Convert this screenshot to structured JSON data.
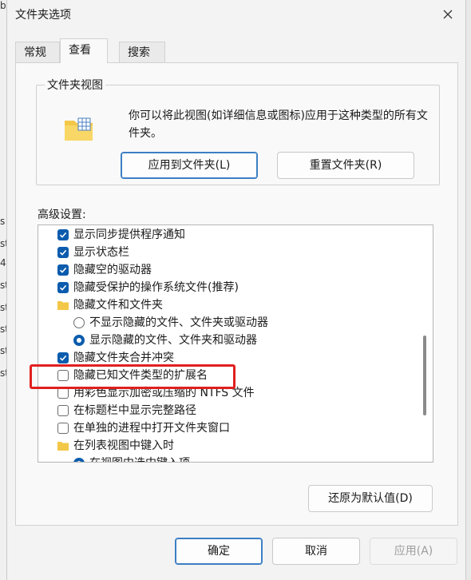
{
  "window": {
    "title": "文件夹选项",
    "close_glyph": "✕"
  },
  "tabs": [
    {
      "label": "常规",
      "active": false
    },
    {
      "label": "查看",
      "active": true
    },
    {
      "label": "搜索",
      "active": false
    }
  ],
  "folder_views": {
    "group_title": "文件夹视图",
    "description": "你可以将此视图(如详细信息或图标)应用于这种类型的所有文件夹。",
    "apply_button": "应用到文件夹(L)",
    "reset_button": "重置文件夹(R)",
    "icon": "folder-grid-icon"
  },
  "advanced": {
    "label": "高级设置:",
    "items": [
      {
        "type": "checkbox",
        "checked": true,
        "label": "显示同步提供程序通知"
      },
      {
        "type": "checkbox",
        "checked": true,
        "label": "显示状态栏"
      },
      {
        "type": "checkbox",
        "checked": true,
        "label": "隐藏空的驱动器"
      },
      {
        "type": "checkbox",
        "checked": true,
        "label": "隐藏受保护的操作系统文件(推荐)"
      },
      {
        "type": "folder",
        "label": "隐藏文件和文件夹"
      },
      {
        "type": "radio",
        "checked": false,
        "label": "不显示隐藏的文件、文件夹或驱动器"
      },
      {
        "type": "radio",
        "checked": true,
        "label": "显示隐藏的文件、文件夹和驱动器"
      },
      {
        "type": "checkbox",
        "checked": true,
        "label": "隐藏文件夹合并冲突"
      },
      {
        "type": "checkbox",
        "checked": false,
        "label": "隐藏已知文件类型的扩展名"
      },
      {
        "type": "checkbox",
        "checked": false,
        "label": "用彩色显示加密或压缩的 NTFS 文件"
      },
      {
        "type": "checkbox",
        "checked": false,
        "label": "在标题栏中显示完整路径"
      },
      {
        "type": "checkbox",
        "checked": false,
        "label": "在单独的进程中打开文件夹窗口"
      },
      {
        "type": "folder",
        "label": "在列表视图中键入时"
      },
      {
        "type": "radio",
        "checked": true,
        "label": "在视图中选中键入项"
      }
    ],
    "restore_button": "还原为默认值(D)"
  },
  "footer": {
    "ok": "确定",
    "cancel": "取消",
    "apply": "应用(A)"
  },
  "background_glyphs": [
    "b",
    "s",
    "st",
    "4",
    "st",
    "st",
    "st",
    "st",
    "st"
  ],
  "colors": {
    "accent": "#0b5cad",
    "highlight": "#e0201f"
  }
}
